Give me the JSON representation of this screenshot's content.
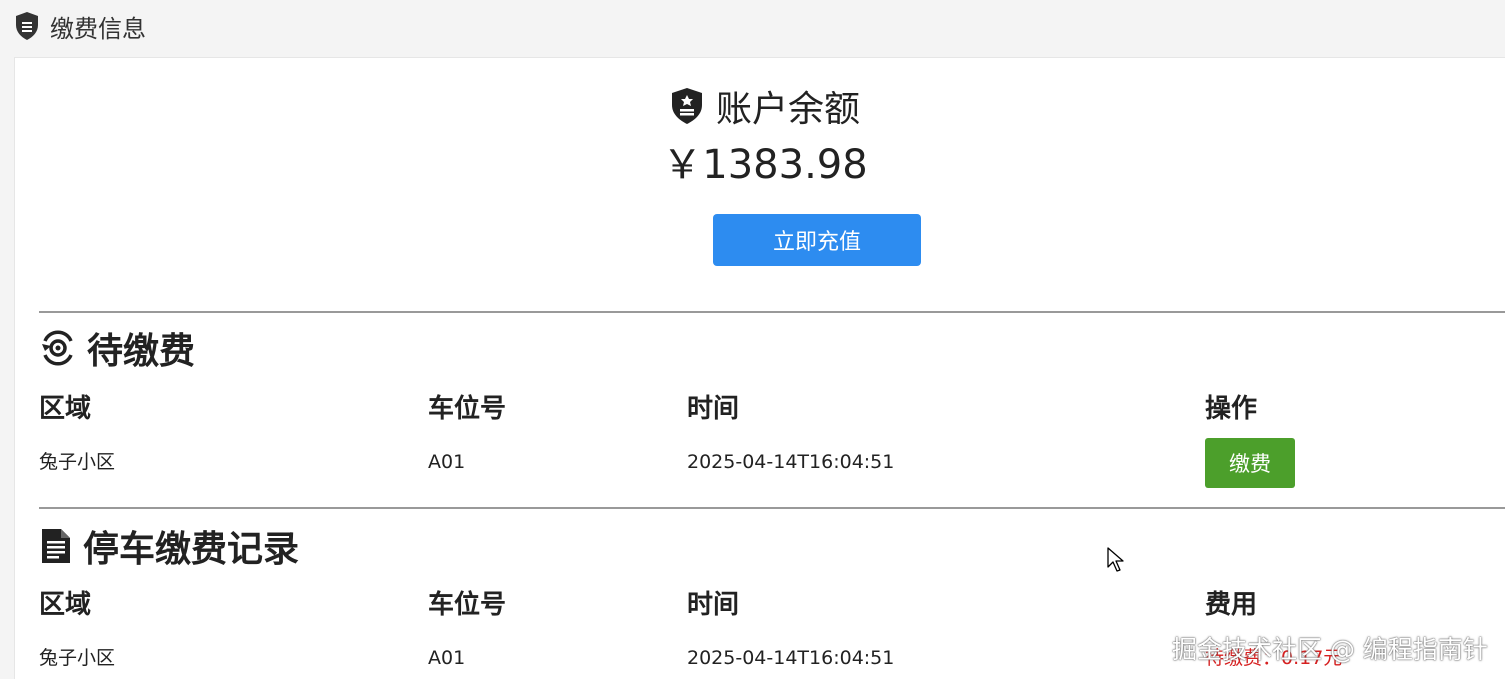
{
  "header": {
    "icon": "shield-icon",
    "title": "缴费信息"
  },
  "balance": {
    "icon": "shield-icon",
    "title": "账户余额",
    "amount": "￥1383.98",
    "recharge_label": "立即充值",
    "recharge_color": "#2d8cf0"
  },
  "pending": {
    "icon": "pending-payment-icon",
    "title": "待缴费",
    "columns": [
      "区域",
      "车位号",
      "时间",
      "操作"
    ],
    "rows": [
      {
        "area": "兔子小区",
        "spot": "A01",
        "time": "2025-04-14T16:04:51",
        "action_label": "缴费"
      }
    ],
    "action_color": "#4c9f2b"
  },
  "records": {
    "icon": "document-icon",
    "title": "停车缴费记录",
    "columns": [
      "区域",
      "车位号",
      "时间",
      "费用"
    ],
    "rows": [
      {
        "area": "兔子小区",
        "spot": "A01",
        "time": "2025-04-14T16:04:51",
        "fee": "待缴费：0.17元"
      }
    ],
    "fee_color": "#d62020"
  },
  "watermark": "掘金技术社区 @ 编程指南针"
}
